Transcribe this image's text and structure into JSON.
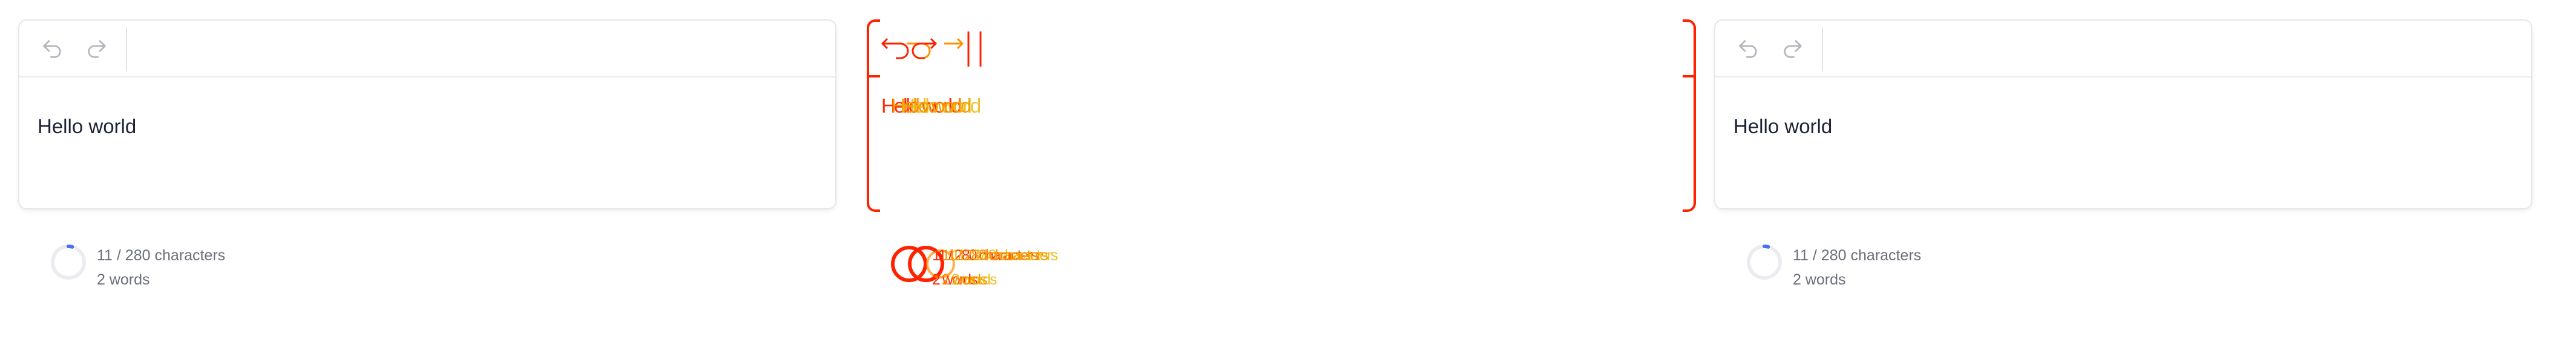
{
  "editor": {
    "undo_icon": "undo-icon",
    "redo_icon": "redo-icon",
    "text": "Hello world"
  },
  "counter": {
    "characters": "11 / 280 characters",
    "words": "2 words",
    "progress_fraction": 0.039
  },
  "colors": {
    "accent": "#4a6cf7",
    "ring_track": "#ececf0",
    "overlay_red": "#ff2200",
    "overlay_orange": "#ff9000"
  }
}
